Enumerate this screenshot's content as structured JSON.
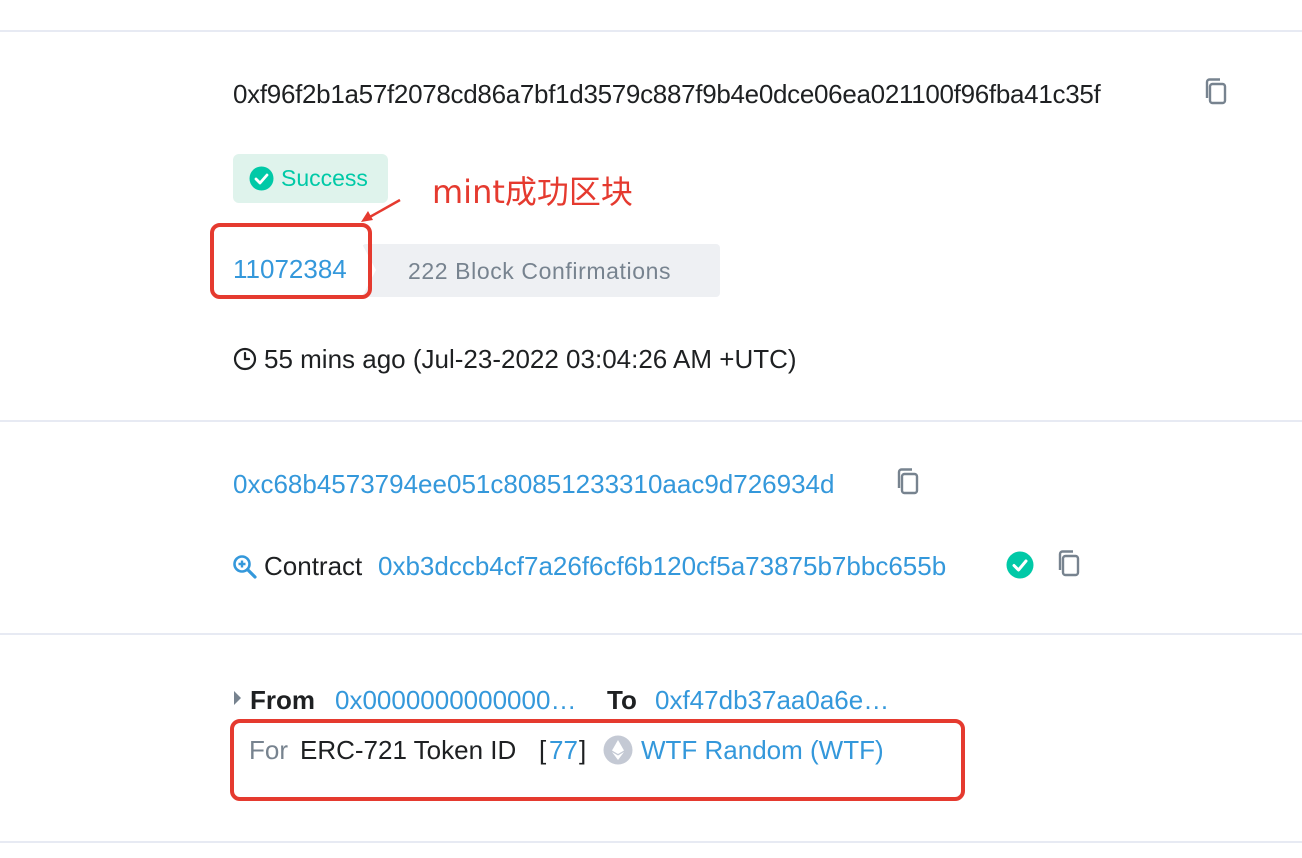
{
  "tx": {
    "hash": "0xf96f2b1a57f2078cd86a7bf1d3579c887f9b4e0dce06ea021100f96fba41c35f",
    "status": "Success",
    "block_number": "11072384",
    "confirmations": "222 Block Confirmations",
    "timestamp": "55 mins ago (Jul-23-2022 03:04:26 AM +UTC)"
  },
  "annotation": {
    "text": "mint成功区块",
    "color": "#e53a2f"
  },
  "from_address": "0xc68b4573794ee051c80851233310aac9d726934d",
  "interacted_with": {
    "prefix": "Contract",
    "address": "0xb3dccb4cf7a26f6cf6b120cf5a73875b7bbc655b"
  },
  "token_transfer": {
    "from_label": "From",
    "from_address": "0x0000000000000…",
    "to_label": "To",
    "to_address": "0xf47db37aa0a6e…",
    "for_label": "For",
    "token_type": "ERC-721 Token ID",
    "token_id": "77",
    "token_name": "WTF Random (WTF)"
  },
  "colors": {
    "link": "#3498db",
    "success": "#00c9a7",
    "annotation": "#e53a2f",
    "muted": "#77838f"
  }
}
